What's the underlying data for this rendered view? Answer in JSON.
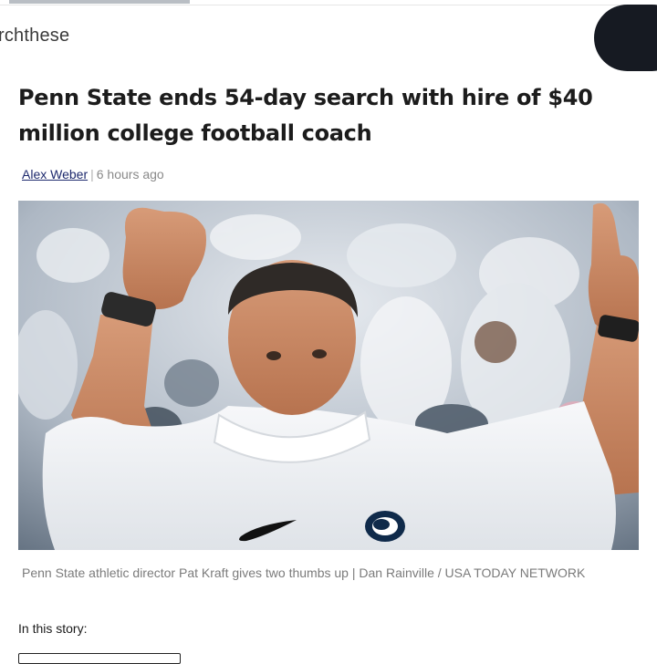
{
  "site": {
    "logo_text": "rchthese"
  },
  "article": {
    "headline": "Penn State ends 54-day search with hire of $40 million college football coach",
    "author": "Alex Weber",
    "separator": "|",
    "published": "6 hours ago",
    "image_caption": "Penn State athletic director Pat Kraft gives two thumbs up | Dan Rainville / USA TODAY NETWORK"
  },
  "story": {
    "label": "In this story:"
  },
  "colors": {
    "pill": "#161a22",
    "author_link": "#1e2a6e",
    "shirt": "#f3f4f6",
    "crowd": "#c9d1da"
  },
  "icons": {
    "swoosh": "nike-swoosh-icon",
    "logo": "nittany-lion-logo-icon"
  }
}
